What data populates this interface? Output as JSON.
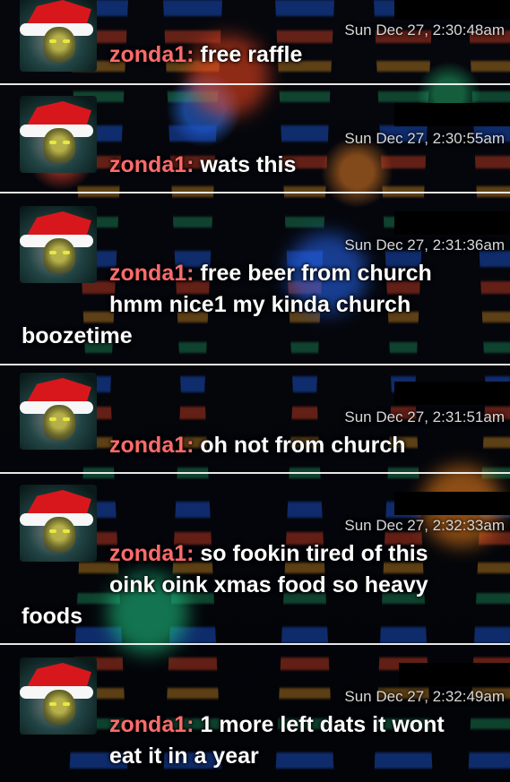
{
  "messages": [
    {
      "user": "zonda1",
      "sep": ": ",
      "time": "Sun Dec 27, 2:30:48am",
      "line1": "free raffle",
      "line2": "",
      "line3": ""
    },
    {
      "user": "zonda1",
      "sep": ": ",
      "time": "Sun Dec 27, 2:30:55am",
      "line1": "wats this",
      "line2": "",
      "line3": ""
    },
    {
      "user": "zonda1",
      "sep": ": ",
      "time": "Sun Dec 27, 2:31:36am",
      "line1": "free beer from church",
      "line2": "hmm nice1 my kinda church",
      "line3": "boozetime"
    },
    {
      "user": "zonda1",
      "sep": ": ",
      "time": "Sun Dec 27, 2:31:51am",
      "line1": "oh not from church",
      "line2": "",
      "line3": ""
    },
    {
      "user": "zonda1",
      "sep": ": ",
      "time": "Sun Dec 27, 2:32:33am",
      "line1": "so fookin tired of this",
      "line2": "oink oink xmas food so heavy",
      "line3": "foods"
    },
    {
      "user": "zonda1",
      "sep": ": ",
      "time": "Sun Dec 27, 2:32:49am",
      "line1": "1 more left dats it wont",
      "line2": "eat it in a year",
      "line3": ""
    }
  ],
  "colors": {
    "username": "#ff6b6b",
    "text": "#ffffff",
    "timestamp": "#d8d8d8",
    "divider": "#ffffff"
  },
  "icons": {
    "avatar": "santa-hat-avatar-icon"
  }
}
